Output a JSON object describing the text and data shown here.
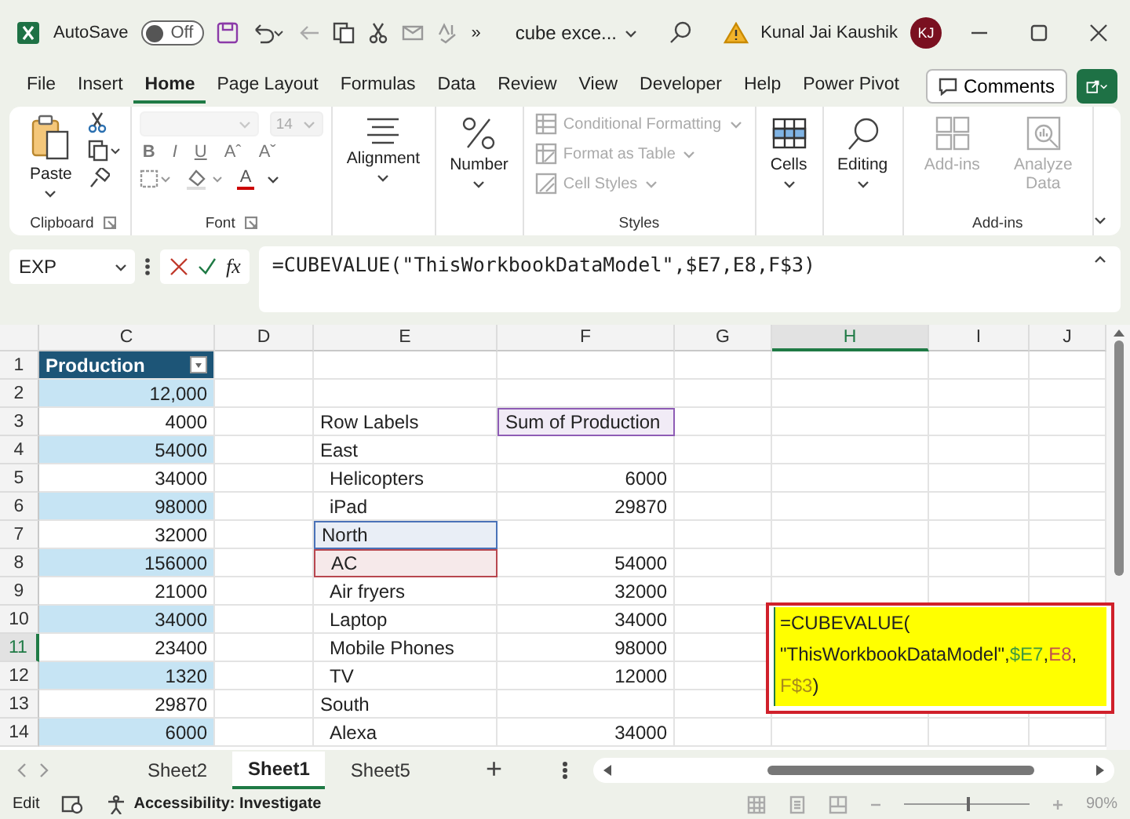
{
  "title_bar": {
    "autosave_label": "AutoSave",
    "autosave": {
      "on": false,
      "label": "Off"
    },
    "overflow": "»",
    "file_name": "cube exce...",
    "user_name": "Kunal Jai Kaushik",
    "user_initials": "KJ"
  },
  "menu_tabs": [
    {
      "label": "File",
      "selected": false
    },
    {
      "label": "Insert",
      "selected": false
    },
    {
      "label": "Home",
      "selected": true
    },
    {
      "label": "Page Layout",
      "selected": false
    },
    {
      "label": "Formulas",
      "selected": false
    },
    {
      "label": "Data",
      "selected": false
    },
    {
      "label": "Review",
      "selected": false
    },
    {
      "label": "View",
      "selected": false
    },
    {
      "label": "Developer",
      "selected": false
    },
    {
      "label": "Help",
      "selected": false
    },
    {
      "label": "Power Pivot",
      "selected": false
    }
  ],
  "comments_button": "Comments",
  "ribbon": {
    "clipboard": {
      "paste": "Paste",
      "label": "Clipboard"
    },
    "font": {
      "disabled": true,
      "size": "14",
      "buttons": [
        "B",
        "I",
        "U",
        "Aˆ",
        "Aˇ"
      ],
      "color_button": "A",
      "label": "Font"
    },
    "alignment": "Alignment",
    "number": "Number",
    "styles": {
      "items": [
        {
          "label": "Conditional Formatting",
          "disabled": true
        },
        {
          "label": "Format as Table",
          "disabled": true
        },
        {
          "label": "Cell Styles",
          "disabled": true
        }
      ],
      "label": "Styles"
    },
    "cells": "Cells",
    "editing": "Editing",
    "addins": {
      "items": [
        {
          "label": "Add-ins",
          "disabled": true
        },
        {
          "label": "Analyze Data",
          "disabled": true
        }
      ],
      "label": "Add-ins"
    }
  },
  "formula_bar": {
    "name_box": "EXP",
    "fx_label": "fx",
    "formula": "=CUBEVALUE(\"ThisWorkbookDataModel\",$E7,E8,F$3)"
  },
  "columns": [
    {
      "label": "C",
      "selected": false
    },
    {
      "label": "D",
      "selected": false
    },
    {
      "label": "E",
      "selected": false
    },
    {
      "label": "F",
      "selected": false
    },
    {
      "label": "G",
      "selected": false
    },
    {
      "label": "H",
      "selected": true
    },
    {
      "label": "I",
      "selected": false
    },
    {
      "label": "J",
      "selected": false
    }
  ],
  "rows": [
    {
      "number": "1",
      "selected": false,
      "c": {
        "text": "Production",
        "kind": "header"
      }
    },
    {
      "number": "2",
      "selected": false,
      "c": {
        "text": "12,000",
        "kind": "value",
        "banded": true
      }
    },
    {
      "number": "3",
      "selected": false,
      "c": {
        "text": "4000",
        "kind": "value",
        "banded": false
      },
      "e": {
        "text": "Row Labels",
        "kind": "label"
      },
      "f": {
        "text": "Sum of Production",
        "kind": "label",
        "color": "#8e5cb5"
      }
    },
    {
      "number": "4",
      "selected": false,
      "c": {
        "text": "54000",
        "kind": "value",
        "banded": true
      },
      "e": {
        "text": "East",
        "kind": "group"
      }
    },
    {
      "number": "5",
      "selected": false,
      "c": {
        "text": "34000",
        "kind": "value",
        "banded": false
      },
      "e": {
        "text": "Helicopters",
        "kind": "item"
      },
      "f": {
        "text": "6000",
        "kind": "value"
      }
    },
    {
      "number": "6",
      "selected": false,
      "c": {
        "text": "98000",
        "kind": "value",
        "banded": true
      },
      "e": {
        "text": "iPad",
        "kind": "item"
      },
      "f": {
        "text": "29870",
        "kind": "value"
      }
    },
    {
      "number": "7",
      "selected": false,
      "c": {
        "text": "32000",
        "kind": "value",
        "banded": false
      },
      "e": {
        "text": "North",
        "kind": "group",
        "color": "#4a72b8"
      }
    },
    {
      "number": "8",
      "selected": false,
      "c": {
        "text": "156000",
        "kind": "value",
        "banded": true
      },
      "e": {
        "text": "AC",
        "kind": "item",
        "color": "#b8474f"
      },
      "f": {
        "text": "54000",
        "kind": "value"
      }
    },
    {
      "number": "9",
      "selected": false,
      "c": {
        "text": "21000",
        "kind": "value",
        "banded": false
      },
      "e": {
        "text": "Air fryers",
        "kind": "item"
      },
      "f": {
        "text": "32000",
        "kind": "value"
      }
    },
    {
      "number": "10",
      "selected": false,
      "c": {
        "text": "34000",
        "kind": "value",
        "banded": true
      },
      "e": {
        "text": "Laptop",
        "kind": "item"
      },
      "f": {
        "text": "34000",
        "kind": "value"
      }
    },
    {
      "number": "11",
      "selected": true,
      "c": {
        "text": "23400",
        "kind": "value",
        "banded": false
      },
      "e": {
        "text": "Mobile Phones",
        "kind": "item"
      },
      "f": {
        "text": "98000",
        "kind": "value"
      }
    },
    {
      "number": "12",
      "selected": false,
      "c": {
        "text": "1320",
        "kind": "value",
        "banded": true
      },
      "e": {
        "text": "TV",
        "kind": "item"
      },
      "f": {
        "text": "12000",
        "kind": "value"
      }
    },
    {
      "number": "13",
      "selected": false,
      "c": {
        "text": "29870",
        "kind": "value",
        "banded": false
      },
      "e": {
        "text": "South",
        "kind": "group"
      }
    },
    {
      "number": "14",
      "selected": false,
      "c": {
        "text": "6000",
        "kind": "value",
        "banded": true
      },
      "e": {
        "text": "Alexa",
        "kind": "item"
      },
      "f": {
        "text": "34000",
        "kind": "value"
      }
    }
  ],
  "formula_popup": {
    "lines": [
      [
        {
          "text": "=CUBEVALUE("
        }
      ],
      [
        {
          "text": "\"ThisWorkbookDataModel\","
        },
        {
          "text": "$E7",
          "color": "#3f9a3f"
        },
        {
          "text": ","
        },
        {
          "text": "E8",
          "color": "#c0504d"
        },
        {
          "text": ","
        }
      ],
      [
        {
          "text": "F$3",
          "color": "#a88a1c"
        },
        {
          "text": ")"
        }
      ]
    ]
  },
  "sheet_tabs": [
    {
      "label": "Sheet2",
      "selected": false
    },
    {
      "label": "Sheet1",
      "selected": true
    },
    {
      "label": "Sheet5",
      "selected": false
    }
  ],
  "add_sheet": "+",
  "status_bar": {
    "mode": "Edit",
    "accessibility": "Accessibility: Investigate",
    "zoom": {
      "level": 0.5,
      "label": "90%"
    }
  }
}
